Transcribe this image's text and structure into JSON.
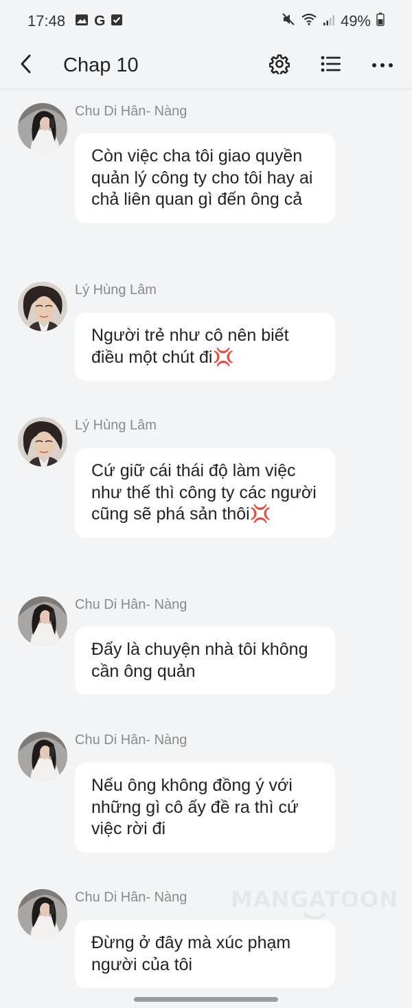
{
  "status_bar": {
    "time": "17:48",
    "notification_icons": [
      "image-icon",
      "google-icon",
      "check-box-icon"
    ],
    "system_icons": [
      "mute-icon",
      "wifi-icon",
      "signal-icon"
    ],
    "battery": "49%"
  },
  "header": {
    "title": "Chap 10",
    "back_icon": "chevron-left-icon",
    "settings_icon": "gear-icon",
    "list_icon": "list-icon",
    "more_icon": "more-horizontal-icon"
  },
  "messages": [
    {
      "sender": "Chu Di Hân- Nàng",
      "avatar": "female-avatar",
      "text": "Còn việc cha tôi giao quyền quản lý công ty cho tôi hay ai chả liên quan gì đến ông cả"
    },
    {
      "sender": "Lý Hùng Lâm",
      "avatar": "male-avatar",
      "text": "Người trẻ như cô nên biết điều một chút đi💢"
    },
    {
      "sender": "Lý Hùng Lâm",
      "avatar": "male-avatar",
      "text": "Cứ giữ cái thái độ làm việc như thế thì công ty các người cũng sẽ phá sản thôi💢"
    },
    {
      "sender": "Chu Di Hân- Nàng",
      "avatar": "female-avatar",
      "text": "Đấy là chuyện nhà tôi không cần ông quản"
    },
    {
      "sender": "Chu Di Hân- Nàng",
      "avatar": "female-avatar",
      "text": "Nếu ông không đồng ý với những gì cô ấy đề ra thì cứ việc rời đi"
    },
    {
      "sender": "Chu Di Hân- Nàng",
      "avatar": "female-avatar",
      "text": "Đừng ở đây mà xúc phạm người của tôi"
    }
  ],
  "watermark": "MANGATOON",
  "colors": {
    "background": "#f3f4f6",
    "bubble": "#ffffff",
    "sender_text": "#8a8a8a",
    "message_text": "#222222"
  }
}
